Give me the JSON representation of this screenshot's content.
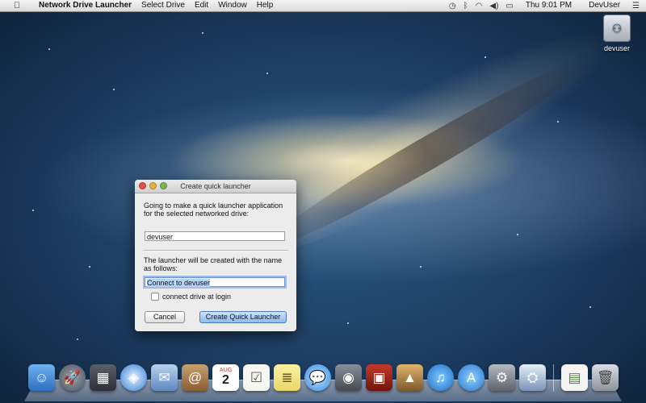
{
  "menubar": {
    "apple": "",
    "app_name": "Network Drive Launcher",
    "menus": [
      "Select Drive",
      "Edit",
      "Window",
      "Help"
    ],
    "clock": "Thu 9:01 PM",
    "user": "DevUser",
    "status_icons": [
      "time-machine-icon",
      "bluetooth-icon",
      "wifi-icon",
      "volume-icon",
      "battery-icon"
    ]
  },
  "desktop": {
    "drive_label": "devuser"
  },
  "dialog": {
    "title": "Create quick launcher",
    "intro": "Going to make a quick launcher application for the selected networked drive:",
    "drive_value": "devuser",
    "description": "The launcher will be created with the name as follows:",
    "name_value": "Connect to devuser",
    "checkbox_label": "connect drive at login",
    "checkbox_checked": false,
    "cancel_label": "Cancel",
    "create_label": "Create Quick Launcher"
  },
  "dock": {
    "apps": [
      "finder-icon",
      "launchpad-icon",
      "mission-control-icon",
      "safari-icon",
      "mail-icon",
      "contacts-icon",
      "calendar-icon",
      "reminders-icon",
      "notes-icon",
      "messages-icon",
      "facetime-icon",
      "photo-booth-icon",
      "iphoto-icon",
      "itunes-icon",
      "app-store-icon",
      "system-preferences-icon",
      "network-drive-launcher-icon"
    ],
    "calendar_month": "AUG",
    "calendar_day": "2",
    "stack": "documents-stack-icon",
    "trash": "trash-icon"
  }
}
